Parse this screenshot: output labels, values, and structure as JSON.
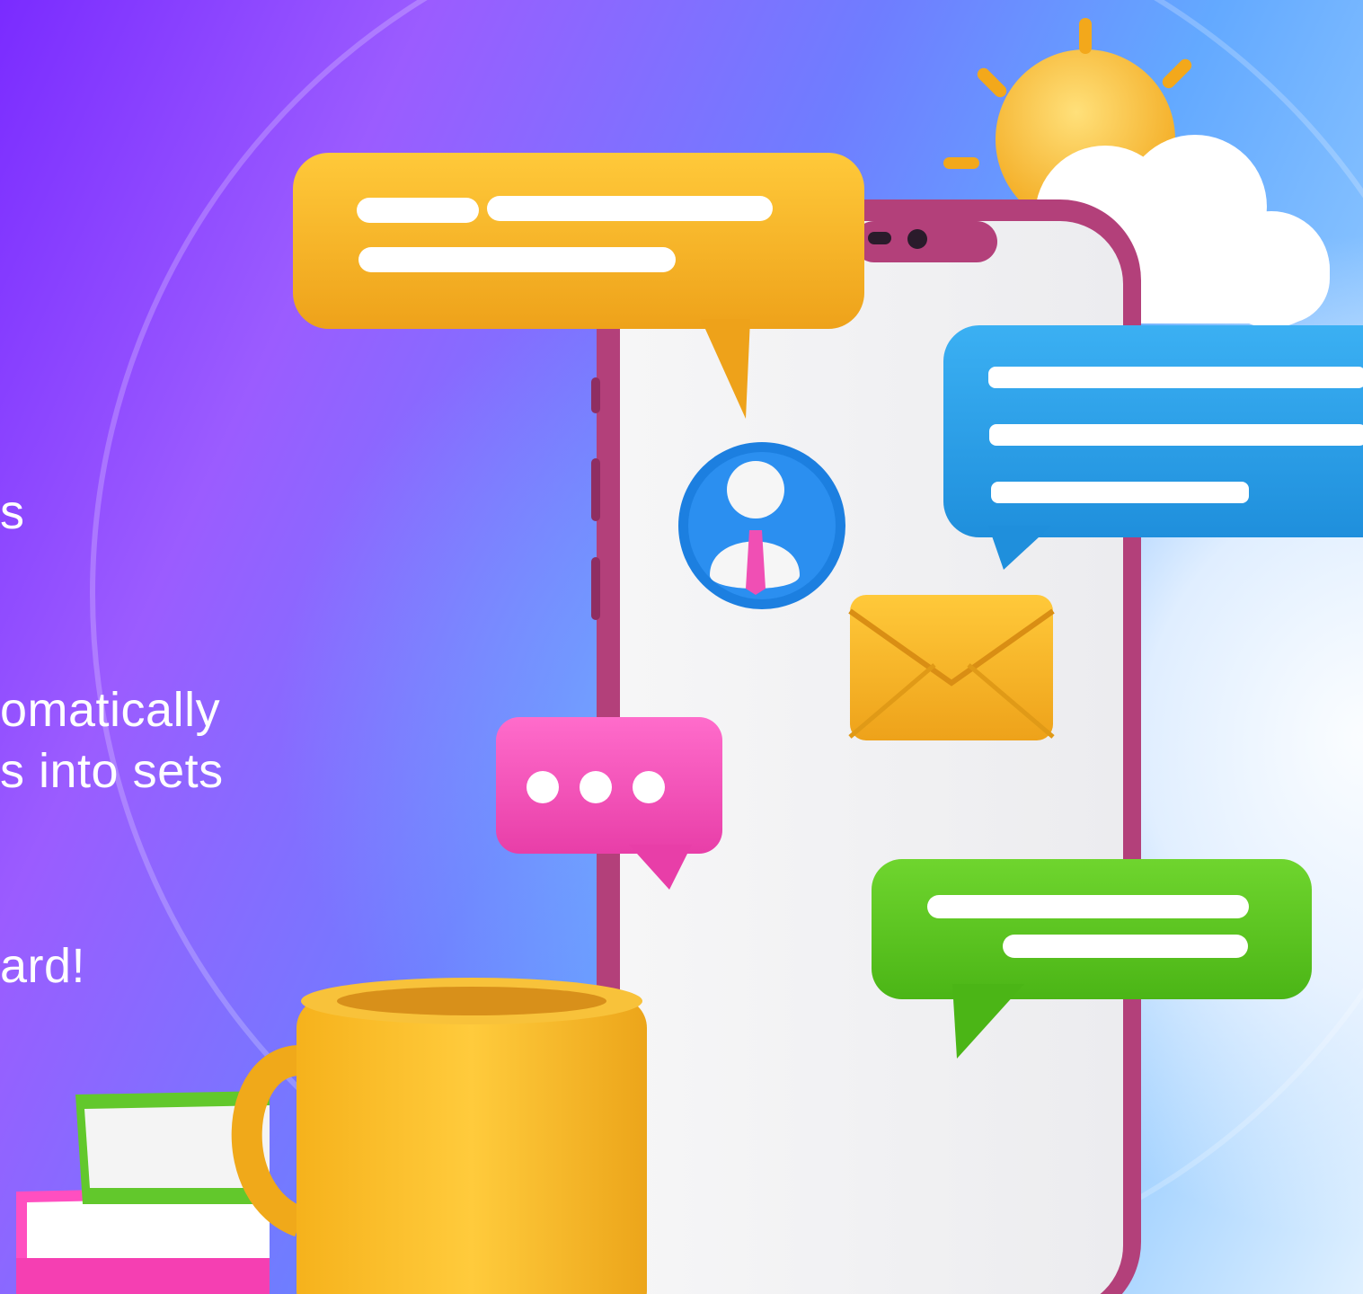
{
  "marketing_copy": {
    "line_1": "s",
    "line_2": "omatically",
    "line_3": "s into sets",
    "line_4": "ard!"
  },
  "illustration": {
    "icons": [
      "speech-bubble-icon",
      "user-avatar-icon",
      "envelope-icon",
      "typing-indicator-icon",
      "sun-icon",
      "cloud-icon",
      "mug-icon",
      "books-icon",
      "smartphone-icon"
    ],
    "colors": {
      "yellow": "#f3b21f",
      "blue": "#2f9fe8",
      "green": "#57c21f",
      "pink": "#f04fb4",
      "phone_frame": "#b3407a",
      "purple_bg": "#7a2bff",
      "light_blue_bg": "#8fc8ff"
    }
  }
}
